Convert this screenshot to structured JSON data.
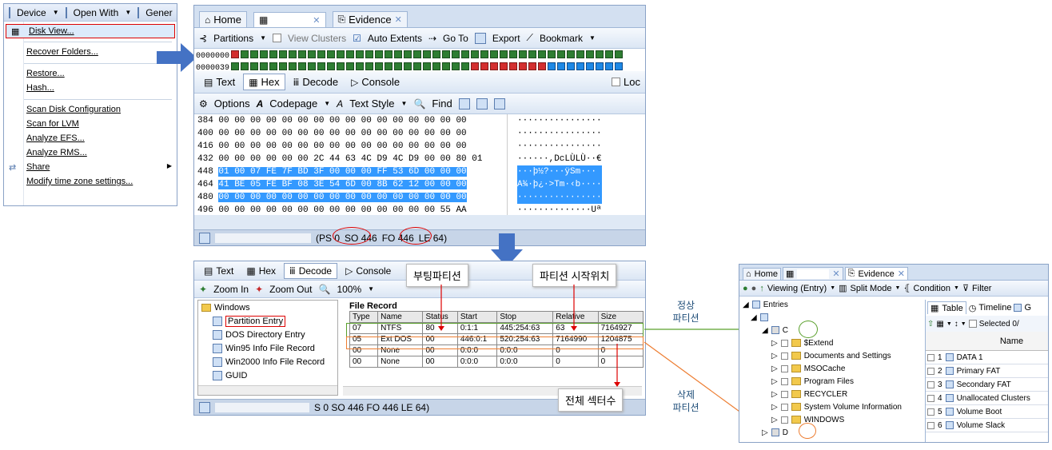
{
  "menu_panel": {
    "toolbar": {
      "device": "Device",
      "open_with": "Open With",
      "generic": "Gener"
    },
    "items": [
      {
        "label": "Disk View..."
      },
      {
        "label": "Recover Folders..."
      },
      {
        "label": "Restore..."
      },
      {
        "label": "Hash..."
      },
      {
        "label": "Scan Disk Configuration"
      },
      {
        "label": "Scan for LVM"
      },
      {
        "label": "Analyze EFS..."
      },
      {
        "label": "Analyze RMS..."
      },
      {
        "label": "Share"
      },
      {
        "label": "Modify time zone settings..."
      }
    ]
  },
  "disk_view": {
    "tabs": {
      "home": "Home",
      "evidence": "Evidence"
    },
    "toolbar": {
      "partitions": "Partitions",
      "view_clusters": "View Clusters",
      "auto_extents": "Auto Extents",
      "go_to": "Go To",
      "export": "Export",
      "bookmark": "Bookmark"
    },
    "cluster_rows": [
      {
        "label": "0000000"
      },
      {
        "label": "0000039"
      }
    ],
    "view_tabs": {
      "text": "Text",
      "hex": "Hex",
      "decode": "Decode",
      "console": "Console",
      "lock": "Loc"
    },
    "hex_toolbar": {
      "options": "Options",
      "codepage": "Codepage",
      "text_style": "Text Style",
      "find": "Find"
    },
    "hex_rows": [
      {
        "offset": "384",
        "bytes": "00 00 00 00 00 00 00 00 00 00 00 00 00 00 00 00",
        "ascii": "················"
      },
      {
        "offset": "400",
        "bytes": "00 00 00 00 00 00 00 00 00 00 00 00 00 00 00 00",
        "ascii": "················"
      },
      {
        "offset": "416",
        "bytes": "00 00 00 00 00 00 00 00 00 00 00 00 00 00 00 00",
        "ascii": "················"
      },
      {
        "offset": "432",
        "bytes": "00 00 00 00 00 00 2C 44 63 4C D9 4C D9 00 00 80 01",
        "ascii": "······,DcLÙLÙ··€"
      },
      {
        "offset": "448",
        "bytes": "01 00 07 FE 7F BD 3F 00 00 00 FF 53 6D 00 00 00",
        "ascii": "···þ½?···ÿSm···"
      },
      {
        "offset": "464",
        "bytes": "41 BE 05 FE BF 08 3E 54 6D 00 8B 62 12 00 00 00",
        "ascii": "A¾·þ¿·>Tm·‹b····"
      },
      {
        "offset": "480",
        "bytes": "00 00 00 00 00 00 00 00 00 00 00 00 00 00 00 00",
        "ascii": "················"
      },
      {
        "offset": "496",
        "bytes": "00 00 00 00 00 00 00 00 00 00 00 00 00 00 55 AA",
        "ascii": "··············Uª"
      }
    ],
    "status": {
      "ps": "(PS 0",
      "so": "SO 446",
      "fo": "FO 446",
      "le": "LE 64)"
    }
  },
  "decode_view": {
    "tabs": {
      "text": "Text",
      "hex": "Hex",
      "decode": "Decode",
      "console": "Console"
    },
    "toolbar": {
      "zoom_in": "Zoom In",
      "zoom_out": "Zoom Out",
      "zoom": "100%"
    },
    "tree": {
      "root": "Windows",
      "items": [
        "Partition Entry",
        "DOS Directory Entry",
        "Win95 Info File Record",
        "Win2000 Info File Record",
        "GUID"
      ]
    },
    "record_title": "File Record",
    "table": {
      "headers": [
        "Type",
        "Name",
        "Status",
        "Start",
        "Stop",
        "Relative",
        "Size"
      ],
      "rows": [
        [
          "07",
          "NTFS",
          "80",
          "0:1:1",
          "445:254:63",
          "63",
          "7164927"
        ],
        [
          "05",
          "Ext DOS",
          "00",
          "446:0:1",
          "520:254:63",
          "7164990",
          "1204875"
        ],
        [
          "00",
          "None",
          "00",
          "0:0:0",
          "0:0:0",
          "0",
          "0"
        ],
        [
          "00",
          "None",
          "00",
          "0:0:0",
          "0:0:0",
          "0",
          "0"
        ]
      ]
    },
    "status": "S 0 SO 446 FO 446 LE 64)"
  },
  "annotations": {
    "boot_partition": "부팅파티션",
    "partition_start": "파티션 시작위치",
    "total_sectors": "전체 섹터수",
    "normal_partition": "정상\n파티션",
    "deleted_partition": "삭제\n파티션"
  },
  "evidence_view": {
    "tabs": {
      "home": "Home",
      "evidence": "Evidence"
    },
    "toolbar": {
      "viewing": "Viewing (Entry)",
      "split_mode": "Split Mode",
      "condition": "Condition",
      "filter": "Filter"
    },
    "tree": {
      "entries": "Entries",
      "c": "C",
      "d": "D",
      "folders": [
        "$Extend",
        "Documents and Settings",
        "MSOCache",
        "Program Files",
        "RECYCLER",
        "System Volume Information",
        "WINDOWS"
      ]
    },
    "list_tabs": {
      "table": "Table",
      "timeline": "Timeline",
      "gallery": "G"
    },
    "list_toolbar": {
      "selected": "Selected 0/"
    },
    "list_header": "Name",
    "list_rows": [
      {
        "num": "1",
        "name": "DATA 1"
      },
      {
        "num": "2",
        "name": "Primary FAT"
      },
      {
        "num": "3",
        "name": "Secondary FAT"
      },
      {
        "num": "4",
        "name": "Unallocated Clusters"
      },
      {
        "num": "5",
        "name": "Volume Boot"
      },
      {
        "num": "6",
        "name": "Volume Slack"
      }
    ]
  }
}
